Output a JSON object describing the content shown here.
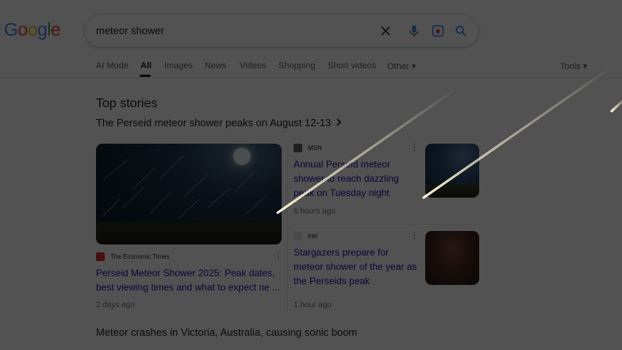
{
  "logo": {
    "letters": [
      {
        "char": "G",
        "color": "#4285f4"
      },
      {
        "char": "o",
        "color": "#ea4335"
      },
      {
        "char": "o",
        "color": "#fbbc05"
      },
      {
        "char": "g",
        "color": "#4285f4"
      },
      {
        "char": "l",
        "color": "#34a853"
      },
      {
        "char": "e",
        "color": "#ea4335"
      }
    ]
  },
  "search": {
    "query": "meteor shower",
    "icons": [
      "close-icon",
      "microphone-icon",
      "lens-icon",
      "search-icon"
    ]
  },
  "tabs": [
    {
      "label": "AI Mode",
      "active": false
    },
    {
      "label": "All",
      "active": true
    },
    {
      "label": "Images",
      "active": false
    },
    {
      "label": "News",
      "active": false
    },
    {
      "label": "Videos",
      "active": false
    },
    {
      "label": "Shopping",
      "active": false
    },
    {
      "label": "Short videos",
      "active": false
    },
    {
      "label": "Other ▾",
      "active": false
    }
  ],
  "tools_label": "Tools ▾",
  "top_stories": {
    "title": "Top stories",
    "headline": "The Perseid meteor shower peaks on August 12-13",
    "main_story": {
      "source": "The Economic Times",
      "title": "Perseid Meteor Shower 2025: Peak dates, best viewing times and what to expect ne ...",
      "time": "2 days ago"
    },
    "side_stories": [
      {
        "source": "MSN",
        "title": "Annual Perseid meteor shower to reach dazzling peak on Tuesday night",
        "time": "6 hours ago"
      },
      {
        "source": "inkl",
        "title": "Stargazers prepare for meteor shower of the year as the Perseids peak",
        "time": "1 hour ago"
      }
    ]
  },
  "next_headline": "Meteor crashes in Victoria, Australia, causing sonic boom",
  "colors": {
    "link": "#1a0dab",
    "overlay": "rgba(0,0,0,0.68)",
    "meteor": "#fff6d8"
  }
}
